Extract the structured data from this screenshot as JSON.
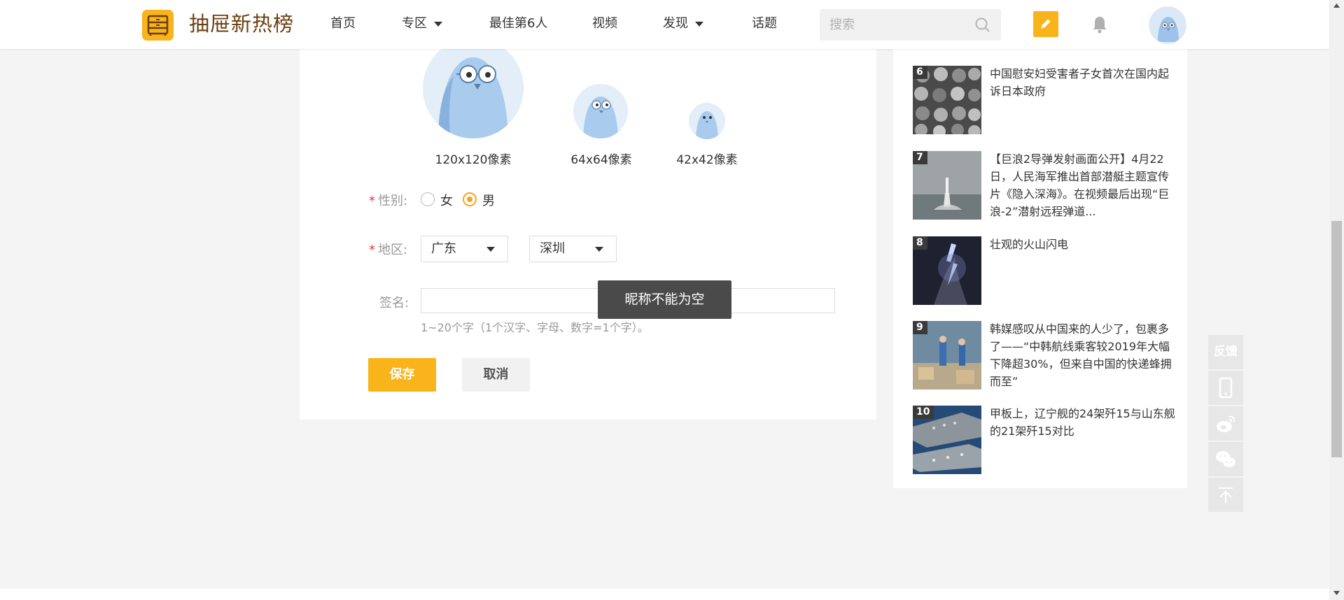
{
  "header": {
    "brand": "抽屉新热榜",
    "nav": [
      {
        "label": "首页",
        "dropdown": false
      },
      {
        "label": "专区",
        "dropdown": true
      },
      {
        "label": "最佳第6人",
        "dropdown": false
      },
      {
        "label": "视频",
        "dropdown": false
      },
      {
        "label": "发现",
        "dropdown": true
      },
      {
        "label": "话题",
        "dropdown": false
      }
    ],
    "search_placeholder": "搜索"
  },
  "avatars": [
    {
      "label": "120x120像素"
    },
    {
      "label": "64x64像素"
    },
    {
      "label": "42x42像素"
    }
  ],
  "form": {
    "gender_label": "性别:",
    "gender_options": [
      "女",
      "男"
    ],
    "gender_selected": "男",
    "region_label": "地区:",
    "province": "广东",
    "city": "深圳",
    "signature_label": "签名:",
    "signature_value": "",
    "hint": "1~20个字（1个汉字、字母、数字=1个字）。",
    "save_label": "保存",
    "cancel_label": "取消"
  },
  "toast": "昵称不能为空",
  "sidebar_ranking": [
    {
      "rank": "6",
      "title": "中国慰安妇受害者子女首次在国内起诉日本政府"
    },
    {
      "rank": "7",
      "title": "【巨浪2导弹发射画面公开】4月22日，人民海军推出首部潜艇主题宣传片《隐入深海》。在视频最后出现“巨浪-2”潜射远程弹道..."
    },
    {
      "rank": "8",
      "title": "壮观的火山闪电"
    },
    {
      "rank": "9",
      "title": "韩媒感叹从中国来的人少了，包裹多了——“中韩航线乘客较2019年大幅下降超30%，但来自中国的快递蜂拥而至”"
    },
    {
      "rank": "10",
      "title": "甲板上，辽宁舰的24架歼15与山东舰的21架歼15对比"
    }
  ],
  "float_tools": {
    "feedback_label": "反馈"
  },
  "colors": {
    "accent": "#f9b31b",
    "brand_text": "#6b3e0f",
    "toast_bg": "#4a4a4a",
    "required": "#e23b3b"
  }
}
